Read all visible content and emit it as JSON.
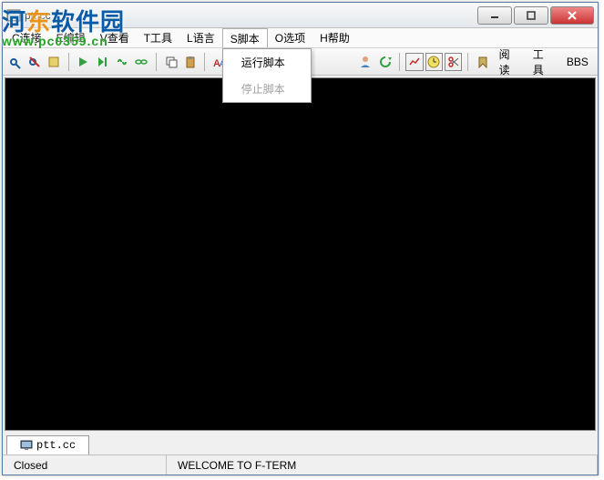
{
  "title": "ptt.cc",
  "watermark": {
    "text_prefix": "河",
    "text_orange": "东",
    "text_suffix": "软件园",
    "url": "www.pc0359.cn"
  },
  "menu": {
    "connect": "C连接",
    "edit": "E编辑",
    "view": "V查看",
    "tool": "T工具",
    "language": "L语言",
    "script": "S脚本",
    "option": "O选项",
    "help": "H帮助"
  },
  "dropdown": {
    "run_script": "运行脚本",
    "stop_script": "停止脚本"
  },
  "toolbar_text": {
    "read": "阅读",
    "tool": "工具",
    "bbs": "BBS"
  },
  "tab": {
    "label": "ptt.cc"
  },
  "status": {
    "state": "Closed",
    "welcome": "WELCOME TO F-TERM"
  }
}
